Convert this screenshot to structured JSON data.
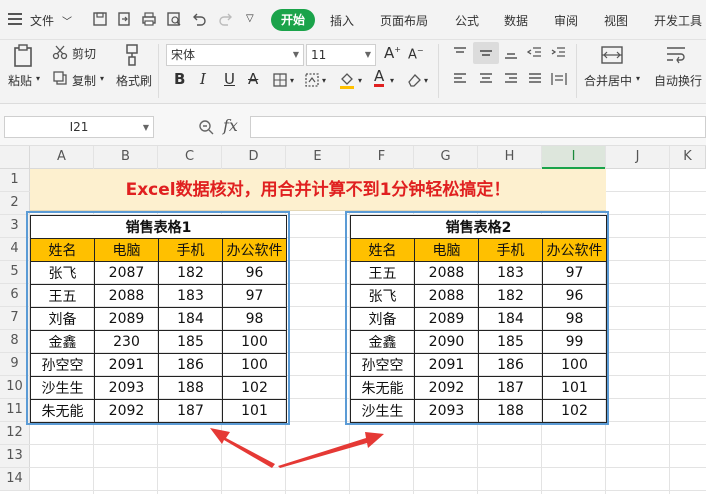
{
  "menubar": {
    "file_label": "文件",
    "tabs": [
      "开始",
      "插入",
      "页面布局",
      "公式",
      "数据",
      "审阅",
      "视图",
      "开发工具"
    ]
  },
  "ribbon": {
    "paste": "粘贴",
    "cut": "剪切",
    "copy": "复制",
    "format_painter": "格式刷",
    "font_name": "宋体",
    "font_size": "11",
    "bold": "B",
    "italic": "I",
    "underline": "U",
    "strike": "A",
    "font_color": "A",
    "increase_font": "A",
    "decrease_font": "A",
    "merge_center": "合并居中",
    "wrap_text": "自动换行"
  },
  "formula_bar": {
    "name_box": "I21",
    "fx": "fx",
    "formula": ""
  },
  "grid": {
    "columns": [
      "A",
      "B",
      "C",
      "D",
      "E",
      "F",
      "G",
      "H",
      "I",
      "J",
      "K"
    ],
    "rows": [
      "1",
      "2",
      "3",
      "4",
      "5",
      "6",
      "7",
      "8",
      "9",
      "10",
      "11",
      "12",
      "13",
      "14"
    ],
    "active_column": "I"
  },
  "banner": {
    "text": "Excel数据核对，用合并计算不到1分钟轻松搞定！"
  },
  "table1": {
    "title": "销售表格1",
    "headers": [
      "姓名",
      "电脑",
      "手机",
      "办公软件"
    ],
    "rows": [
      [
        "张飞",
        "2087",
        "182",
        "96"
      ],
      [
        "王五",
        "2088",
        "183",
        "97"
      ],
      [
        "刘备",
        "2089",
        "184",
        "98"
      ],
      [
        "金鑫",
        "230",
        "185",
        "100"
      ],
      [
        "孙空空",
        "2091",
        "186",
        "100"
      ],
      [
        "沙生生",
        "2093",
        "188",
        "102"
      ],
      [
        "朱无能",
        "2092",
        "187",
        "101"
      ]
    ]
  },
  "table2": {
    "title": "销售表格2",
    "headers": [
      "姓名",
      "电脑",
      "手机",
      "办公软件"
    ],
    "rows": [
      [
        "王五",
        "2088",
        "183",
        "97"
      ],
      [
        "张飞",
        "2088",
        "182",
        "96"
      ],
      [
        "刘备",
        "2089",
        "184",
        "98"
      ],
      [
        "金鑫",
        "2090",
        "185",
        "99"
      ],
      [
        "孙空空",
        "2091",
        "186",
        "100"
      ],
      [
        "朱无能",
        "2092",
        "187",
        "101"
      ],
      [
        "沙生生",
        "2093",
        "188",
        "102"
      ]
    ]
  },
  "colors": {
    "accent_green": "#1aa34a",
    "header_fill": "#ffc000",
    "banner_fill": "#fdf0cf",
    "banner_text": "#e02020",
    "box_blue": "#5b9bd5",
    "arrow_red": "#e53935"
  }
}
